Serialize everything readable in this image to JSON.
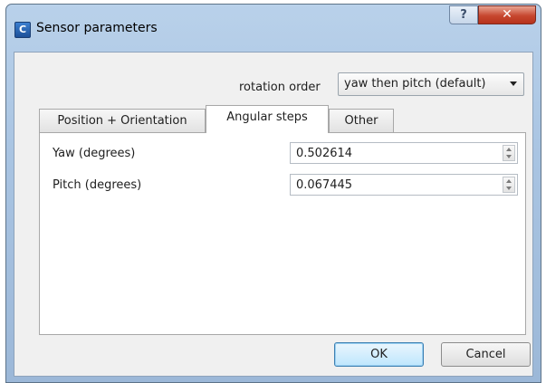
{
  "window": {
    "title": "Sensor parameters",
    "app_icon_glyph": "C",
    "help_glyph": "?",
    "close_glyph": "✕"
  },
  "rotation": {
    "label": "rotation order",
    "selected": "yaw then pitch (default)"
  },
  "tabs": [
    {
      "label": "Position + Orientation",
      "active": false
    },
    {
      "label": "Angular steps",
      "active": true
    },
    {
      "label": "Other",
      "active": false
    }
  ],
  "fields": [
    {
      "label": "Yaw (degrees)",
      "value": "0.502614"
    },
    {
      "label": "Pitch (degrees)",
      "value": "0.067445"
    }
  ],
  "buttons": {
    "ok": "OK",
    "cancel": "Cancel"
  }
}
